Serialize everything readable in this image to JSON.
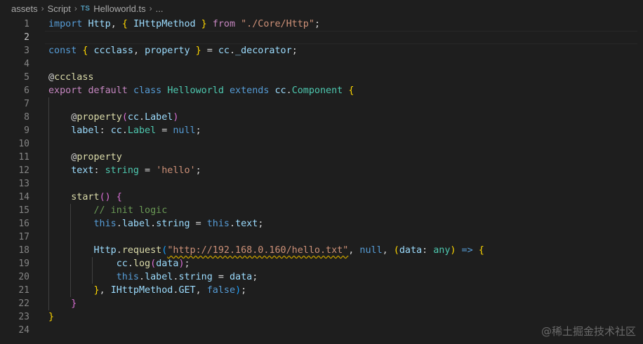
{
  "breadcrumb": {
    "items": [
      "assets",
      "Script"
    ],
    "file_icon": "TS",
    "file_name": "Helloworld.ts",
    "trailing": "..."
  },
  "editor": {
    "active_line": 2,
    "lines": [
      {
        "n": "1",
        "tokens": [
          [
            "kw",
            "import "
          ],
          [
            "var",
            "Http"
          ],
          [
            "txt",
            ", "
          ],
          [
            "b1",
            "{ "
          ],
          [
            "var",
            "IHttpMethod"
          ],
          [
            "b1",
            " }"
          ],
          [
            "ctl",
            " from "
          ],
          [
            "str",
            "\"./Core/Http\""
          ],
          [
            "txt",
            ";"
          ]
        ]
      },
      {
        "n": "2",
        "tokens": []
      },
      {
        "n": "3",
        "tokens": [
          [
            "kw",
            "const "
          ],
          [
            "b1",
            "{ "
          ],
          [
            "var",
            "ccclass"
          ],
          [
            "txt",
            ", "
          ],
          [
            "var",
            "property"
          ],
          [
            "b1",
            " }"
          ],
          [
            "txt",
            " = "
          ],
          [
            "var",
            "cc"
          ],
          [
            "txt",
            "."
          ],
          [
            "var",
            "_decorator"
          ],
          [
            "txt",
            ";"
          ]
        ]
      },
      {
        "n": "4",
        "tokens": []
      },
      {
        "n": "5",
        "tokens": [
          [
            "txt",
            "@"
          ],
          [
            "fn",
            "ccclass"
          ]
        ]
      },
      {
        "n": "6",
        "tokens": [
          [
            "ctl",
            "export "
          ],
          [
            "ctl",
            "default "
          ],
          [
            "kw",
            "class "
          ],
          [
            "typ",
            "Helloworld "
          ],
          [
            "kw",
            "extends "
          ],
          [
            "var",
            "cc"
          ],
          [
            "txt",
            "."
          ],
          [
            "typ",
            "Component "
          ],
          [
            "b1",
            "{"
          ]
        ]
      },
      {
        "n": "7",
        "tokens": []
      },
      {
        "n": "8",
        "tokens": [
          [
            "txt",
            "    @"
          ],
          [
            "fn",
            "property"
          ],
          [
            "b2",
            "("
          ],
          [
            "var",
            "cc"
          ],
          [
            "txt",
            "."
          ],
          [
            "var",
            "Label"
          ],
          [
            "b2",
            ")"
          ]
        ]
      },
      {
        "n": "9",
        "tokens": [
          [
            "txt",
            "    "
          ],
          [
            "var",
            "label"
          ],
          [
            "txt",
            ": "
          ],
          [
            "var",
            "cc"
          ],
          [
            "txt",
            "."
          ],
          [
            "typ",
            "Label"
          ],
          [
            "txt",
            " = "
          ],
          [
            "kw",
            "null"
          ],
          [
            "txt",
            ";"
          ]
        ]
      },
      {
        "n": "10",
        "tokens": []
      },
      {
        "n": "11",
        "tokens": [
          [
            "txt",
            "    @"
          ],
          [
            "fn",
            "property"
          ]
        ]
      },
      {
        "n": "12",
        "tokens": [
          [
            "txt",
            "    "
          ],
          [
            "var",
            "text"
          ],
          [
            "txt",
            ": "
          ],
          [
            "typ",
            "string"
          ],
          [
            "txt",
            " = "
          ],
          [
            "str",
            "'hello'"
          ],
          [
            "txt",
            ";"
          ]
        ]
      },
      {
        "n": "13",
        "tokens": []
      },
      {
        "n": "14",
        "tokens": [
          [
            "txt",
            "    "
          ],
          [
            "fn",
            "start"
          ],
          [
            "b2",
            "()"
          ],
          [
            "txt",
            " "
          ],
          [
            "b2",
            "{"
          ]
        ]
      },
      {
        "n": "15",
        "tokens": [
          [
            "txt",
            "        "
          ],
          [
            "cmt",
            "// init logic"
          ]
        ]
      },
      {
        "n": "16",
        "tokens": [
          [
            "txt",
            "        "
          ],
          [
            "kw",
            "this"
          ],
          [
            "txt",
            "."
          ],
          [
            "var",
            "label"
          ],
          [
            "txt",
            "."
          ],
          [
            "var",
            "string"
          ],
          [
            "txt",
            " = "
          ],
          [
            "kw",
            "this"
          ],
          [
            "txt",
            "."
          ],
          [
            "var",
            "text"
          ],
          [
            "txt",
            ";"
          ]
        ]
      },
      {
        "n": "17",
        "tokens": []
      },
      {
        "n": "18",
        "tokens": [
          [
            "txt",
            "        "
          ],
          [
            "var",
            "Http"
          ],
          [
            "txt",
            "."
          ],
          [
            "fn",
            "request"
          ],
          [
            "b3",
            "("
          ],
          [
            "str_sq",
            "\"http://192.168.0.160/hello.txt\""
          ],
          [
            "txt",
            ", "
          ],
          [
            "kw",
            "null"
          ],
          [
            "txt",
            ", "
          ],
          [
            "b1",
            "("
          ],
          [
            "var",
            "data"
          ],
          [
            "txt",
            ": "
          ],
          [
            "typ",
            "any"
          ],
          [
            "b1",
            ")"
          ],
          [
            "kw",
            " => "
          ],
          [
            "b1",
            "{"
          ]
        ]
      },
      {
        "n": "19",
        "tokens": [
          [
            "txt",
            "            "
          ],
          [
            "var",
            "cc"
          ],
          [
            "txt",
            "."
          ],
          [
            "fn",
            "log"
          ],
          [
            "b2",
            "("
          ],
          [
            "var",
            "data"
          ],
          [
            "b2",
            ")"
          ],
          [
            "txt",
            ";"
          ]
        ]
      },
      {
        "n": "20",
        "tokens": [
          [
            "txt",
            "            "
          ],
          [
            "kw",
            "this"
          ],
          [
            "txt",
            "."
          ],
          [
            "var",
            "label"
          ],
          [
            "txt",
            "."
          ],
          [
            "var",
            "string"
          ],
          [
            "txt",
            " = "
          ],
          [
            "var",
            "data"
          ],
          [
            "txt",
            ";"
          ]
        ]
      },
      {
        "n": "21",
        "tokens": [
          [
            "txt",
            "        "
          ],
          [
            "b1",
            "}"
          ],
          [
            "txt",
            ", "
          ],
          [
            "var",
            "IHttpMethod"
          ],
          [
            "txt",
            "."
          ],
          [
            "var",
            "GET"
          ],
          [
            "txt",
            ", "
          ],
          [
            "kw",
            "false"
          ],
          [
            "b3",
            ")"
          ],
          [
            "txt",
            ";"
          ]
        ]
      },
      {
        "n": "22",
        "tokens": [
          [
            "txt",
            "    "
          ],
          [
            "b2",
            "}"
          ]
        ]
      },
      {
        "n": "23",
        "tokens": [
          [
            "b1",
            "}"
          ]
        ]
      },
      {
        "n": "24",
        "tokens": []
      }
    ]
  },
  "watermark": "@稀土掘金技术社区",
  "colors": {
    "background": "#1e1e1e",
    "keyword": "#569cd6",
    "control": "#c586c0",
    "type": "#4ec9b0",
    "variable": "#9cdcfe",
    "function": "#dcdcaa",
    "string": "#ce9178",
    "comment": "#6a9955"
  }
}
